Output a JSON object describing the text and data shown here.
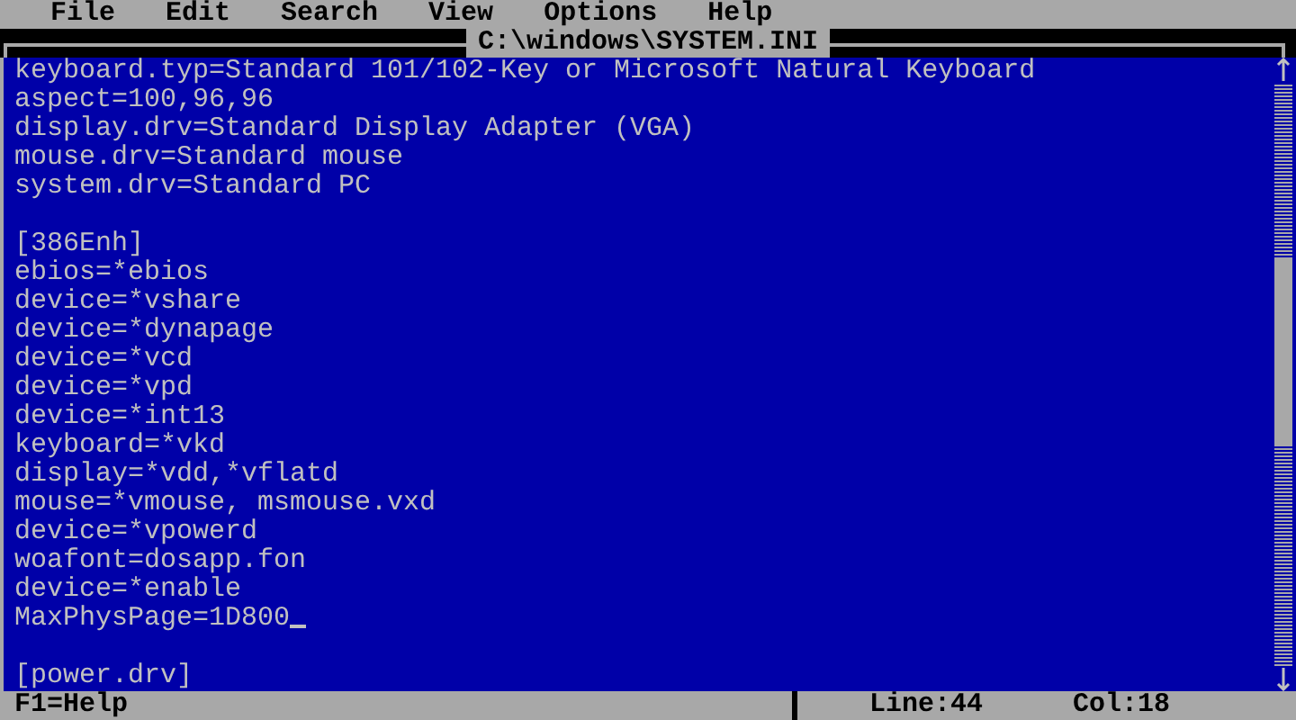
{
  "menu": [
    {
      "label": "File",
      "selected": false
    },
    {
      "label": "Edit",
      "selected": false
    },
    {
      "label": "Search",
      "selected": false
    },
    {
      "label": "View",
      "selected": false
    },
    {
      "label": "Options",
      "selected": false
    },
    {
      "label": "Help",
      "selected": false
    }
  ],
  "editor": {
    "title": "C:\\windows\\SYSTEM.INI",
    "lines": [
      {
        "kind": "text",
        "text": "keyboard.typ=Standard 101/102-Key or Microsoft Natural Keyboard",
        "cursor": false
      },
      {
        "kind": "text",
        "text": "aspect=100,96,96",
        "cursor": false
      },
      {
        "kind": "text",
        "text": "display.drv=Standard Display Adapter (VGA)",
        "cursor": false
      },
      {
        "kind": "text",
        "text": "mouse.drv=Standard mouse",
        "cursor": false
      },
      {
        "kind": "text",
        "text": "system.drv=Standard PC",
        "cursor": false
      },
      {
        "kind": "blank"
      },
      {
        "kind": "text",
        "text": "[386Enh]",
        "cursor": false
      },
      {
        "kind": "text",
        "text": "ebios=*ebios",
        "cursor": false
      },
      {
        "kind": "text",
        "text": "device=*vshare",
        "cursor": false
      },
      {
        "kind": "text",
        "text": "device=*dynapage",
        "cursor": false
      },
      {
        "kind": "text",
        "text": "device=*vcd",
        "cursor": false
      },
      {
        "kind": "text",
        "text": "device=*vpd",
        "cursor": false
      },
      {
        "kind": "text",
        "text": "device=*int13",
        "cursor": false
      },
      {
        "kind": "text",
        "text": "keyboard=*vkd",
        "cursor": false
      },
      {
        "kind": "text",
        "text": "display=*vdd,*vflatd",
        "cursor": false
      },
      {
        "kind": "text",
        "text": "mouse=*vmouse, msmouse.vxd",
        "cursor": false
      },
      {
        "kind": "text",
        "text": "device=*vpowerd",
        "cursor": false
      },
      {
        "kind": "text",
        "text": "woafont=dosapp.fon",
        "cursor": false
      },
      {
        "kind": "text",
        "text": "device=*enable",
        "cursor": false
      },
      {
        "kind": "text",
        "text": "MaxPhysPage=1D800",
        "cursor": true
      },
      {
        "kind": "blank"
      },
      {
        "kind": "text",
        "text": "[power.drv]",
        "cursor": false
      }
    ]
  },
  "status_bar": {
    "help": "F1=Help",
    "line": "Line:44",
    "col": "Col:18"
  }
}
